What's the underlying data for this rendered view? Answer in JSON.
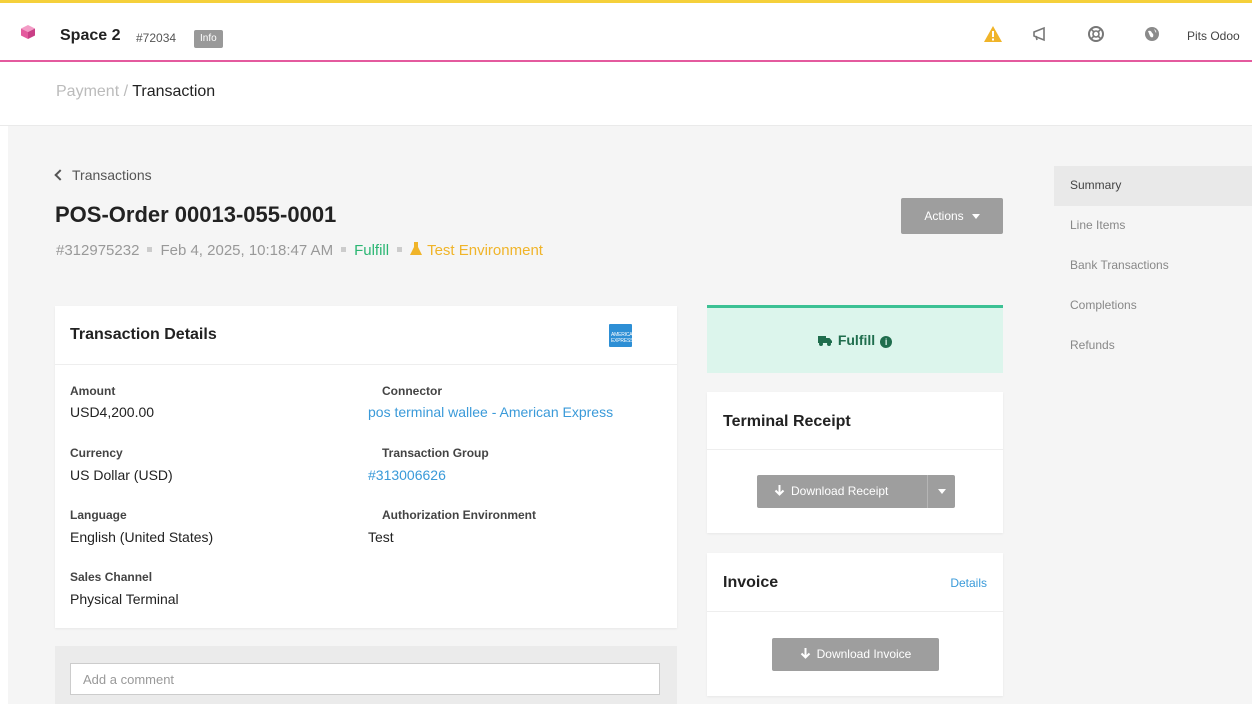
{
  "topbar": {
    "space_name": "Space 2",
    "space_id": "#72034",
    "info_badge": "Info",
    "user_name": "Pits Odoo",
    "icons": [
      "cube-icon",
      "warning-icon",
      "megaphone-icon",
      "lifebuoy-icon",
      "globe-icon"
    ],
    "colors": {
      "top_border": "#f5d03b",
      "bottom_border": "#e45a9e",
      "warning": "#f0b429",
      "cube": "#e45a9e"
    }
  },
  "breadcrumb": {
    "parent": "Payment",
    "separator": "/",
    "current": "Transaction"
  },
  "header": {
    "back_label": "Transactions",
    "title": "POS-Order 00013-055-0001",
    "transaction_id": "#312975232",
    "date": "Feb 4, 2025, 10:18:47 AM",
    "state": "Fulfill",
    "environment": "Test Environment",
    "actions_label": "Actions"
  },
  "sidenav": {
    "items": [
      {
        "label": "Summary",
        "active": true
      },
      {
        "label": "Line Items",
        "active": false
      },
      {
        "label": "Bank Transactions",
        "active": false
      },
      {
        "label": "Completions",
        "active": false
      },
      {
        "label": "Refunds",
        "active": false
      }
    ]
  },
  "details": {
    "title": "Transaction Details",
    "card_brand_icon": "amex-card-icon",
    "amount": {
      "label": "Amount",
      "value": "USD4,200.00"
    },
    "currency": {
      "label": "Currency",
      "value": "US Dollar (USD)"
    },
    "language": {
      "label": "Language",
      "value": "English (United States)"
    },
    "sales_channel": {
      "label": "Sales Channel",
      "value": "Physical Terminal"
    },
    "connector": {
      "label": "Connector",
      "value": "pos terminal wallee - American Express"
    },
    "transaction_group": {
      "label": "Transaction Group",
      "value": "#313006626"
    },
    "authorization_environment": {
      "label": "Authorization Environment",
      "value": "Test"
    }
  },
  "comment": {
    "placeholder": "Add a comment"
  },
  "fulfill_box": {
    "label": "Fulfill",
    "colors": {
      "background": "#dcf5ec",
      "border": "#3cc194",
      "text": "#1f6d4d"
    }
  },
  "terminal_receipt": {
    "title": "Terminal Receipt",
    "download_label": "Download Receipt"
  },
  "invoice": {
    "title": "Invoice",
    "details_link": "Details",
    "download_label": "Download Invoice"
  }
}
